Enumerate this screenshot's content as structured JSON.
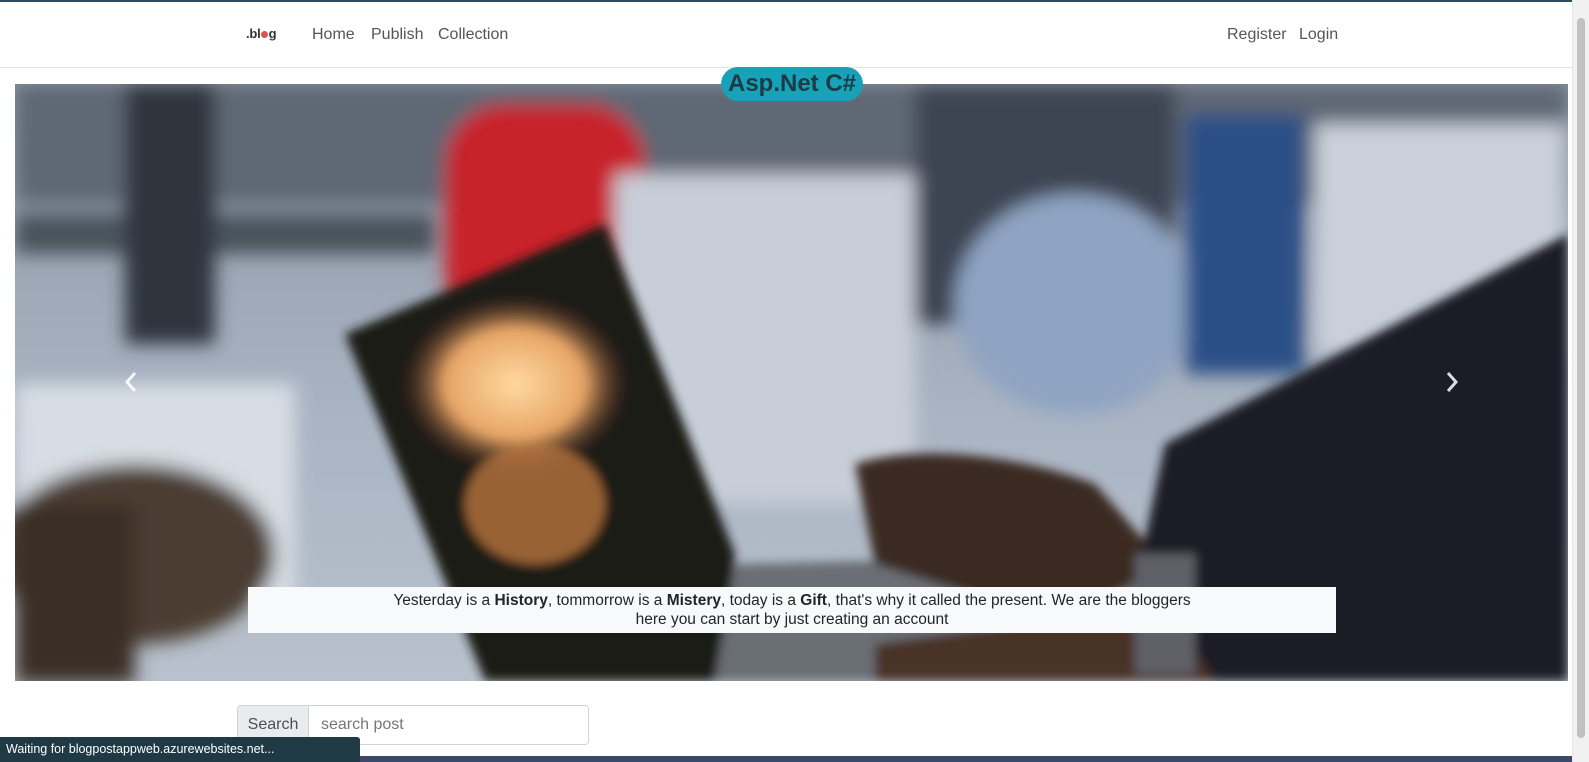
{
  "navbar": {
    "brand": {
      "prefix": ".bl",
      "suffix": "g"
    },
    "links": [
      "Home",
      "Publish",
      "Collection"
    ],
    "auth_links": [
      "Register",
      "Login"
    ]
  },
  "carousel": {
    "badge": "Asp.Net C#",
    "caption": {
      "p1": "Yesterday is a ",
      "b1": "History",
      "p2": ", tommorrow is a ",
      "b2": "Mistery",
      "p3": ", today is a ",
      "b3": "Gift",
      "p4": ", that's why it called the present. We are the bloggers",
      "line2": "here you can start by just creating an account"
    },
    "prev_icon": "chevron-left-icon",
    "next_icon": "chevron-right-icon"
  },
  "search": {
    "label": "Search",
    "placeholder": "search post",
    "value": ""
  },
  "status_bar": {
    "text": "Waiting for blogpostappweb.azurewebsites.net..."
  },
  "colors": {
    "badge_bg": "#17a2b8",
    "caption_bg": "#f8f9fa",
    "status_bg": "#1f3a44"
  }
}
